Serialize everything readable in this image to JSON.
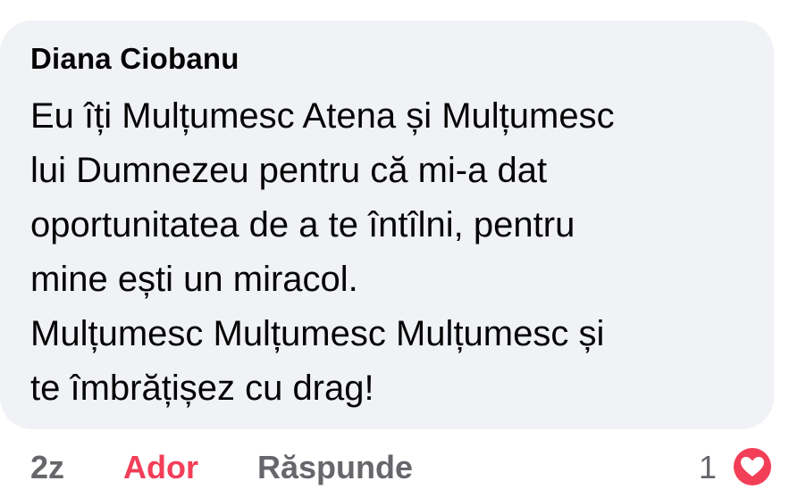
{
  "comment": {
    "author": "Diana Ciobanu",
    "text": "Eu îți Mulțumesc Atena și Mulțumesc\nlui Dumnezeu pentru că mi-a dat\noportunitatea de a te întîlni, pentru\nmine ești un miracol.\nMulțumesc Mulțumesc Mulțumesc și\nte îmbrățișez cu drag!"
  },
  "actions": {
    "time": "2z",
    "like_label": "Ador",
    "reply_label": "Răspunde",
    "reaction_count": "1",
    "reaction_icon": "love-heart-icon"
  },
  "colors": {
    "bubble": "#f0f2f5",
    "like_active": "#f33e58",
    "secondary_text": "#65676b"
  }
}
